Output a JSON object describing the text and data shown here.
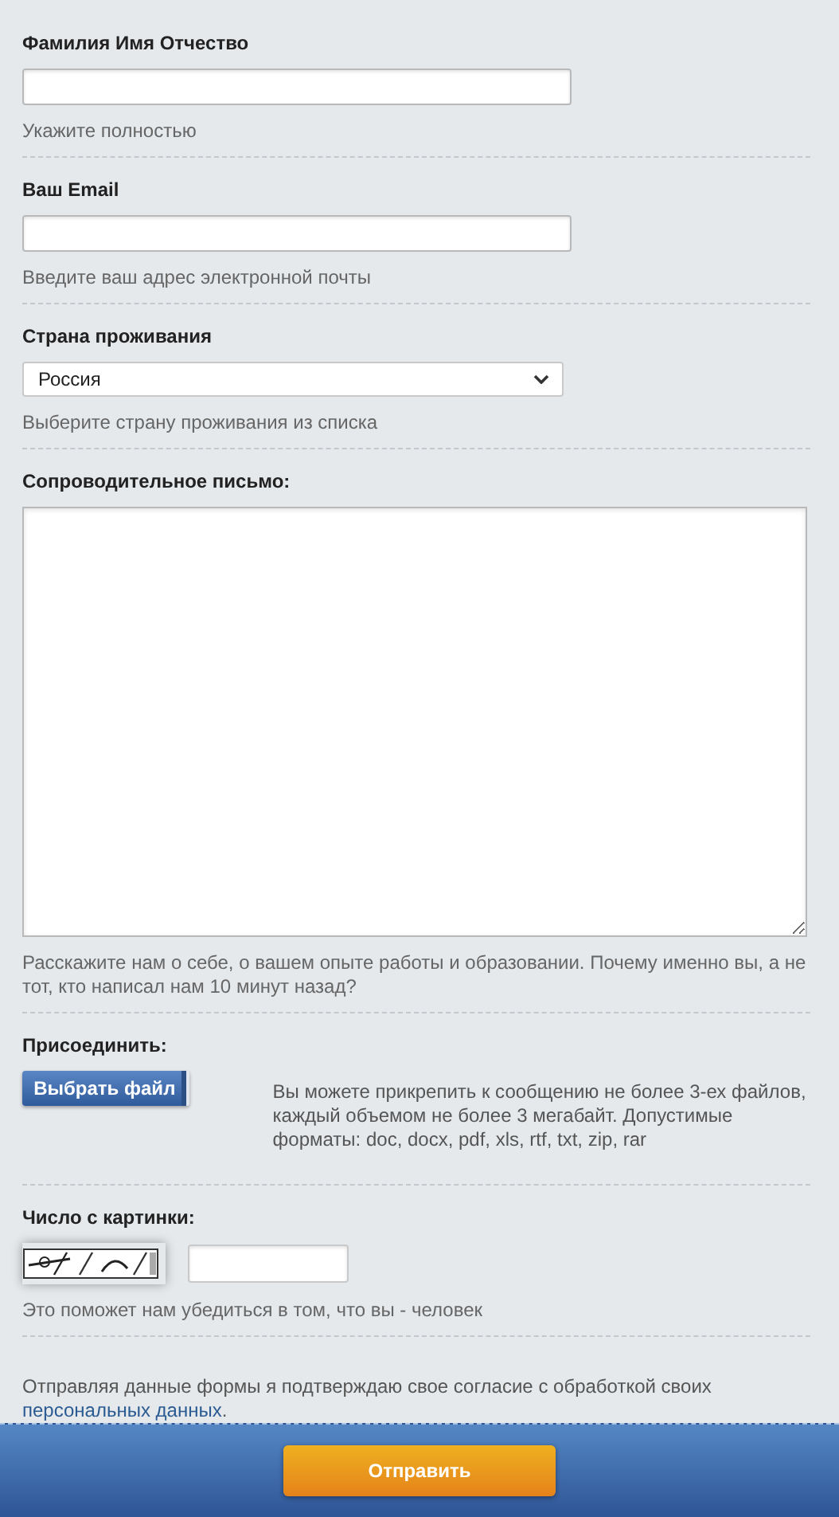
{
  "fields": [
    {
      "kind": "text",
      "label": "Фамилия Имя Отчество",
      "hint": "Укажите полностью"
    },
    {
      "kind": "text",
      "label": "Ваш Email",
      "hint": "Введите ваш адрес электронной почты"
    },
    {
      "kind": "select",
      "label": "Страна проживания",
      "value": "Россия",
      "hint": "Выберите страну проживания из списка"
    },
    {
      "kind": "textarea",
      "label": "Сопроводительное письмо:",
      "hint": "Расскажите нам о себе, о вашем опыте работы и образовании. Почему именно вы, а не тот, кто написал нам 10 минут назад?"
    }
  ],
  "attach": {
    "label": "Присоединить:",
    "button": "Выбрать файл",
    "info": "Вы можете прикрепить к сообщению не более 3-ех файлов, каждый объемом не более 3 мегабайт. Допустимые форматы: doc, docx, pdf, xls, rtf, txt, zip, rar"
  },
  "captcha": {
    "label": "Число с картинки:",
    "hint": "Это поможет нам убедиться в том, что вы - человек"
  },
  "consent": {
    "text": "Отправляя данные формы я подтверждаю свое согласие с обработкой своих",
    "link": "персональных данных",
    "after": "."
  },
  "submit": "Отправить"
}
